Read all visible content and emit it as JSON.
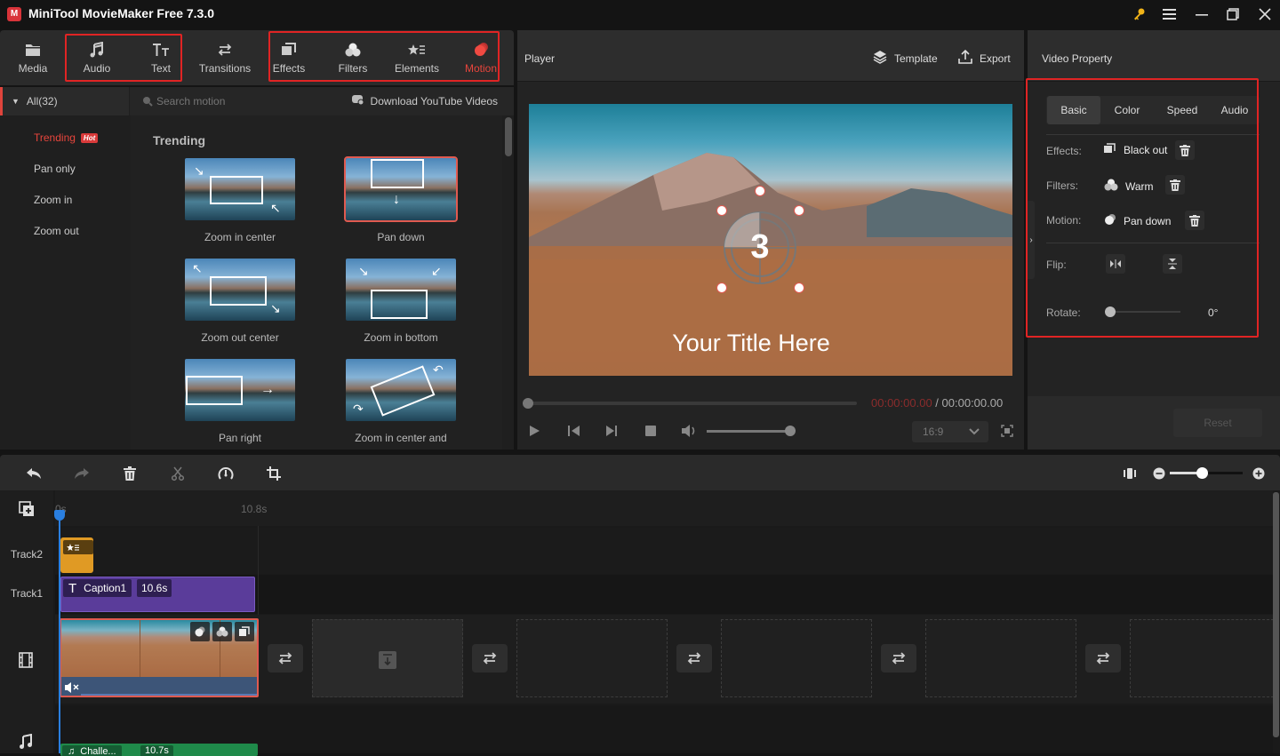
{
  "app": {
    "title": "MiniTool MovieMaker Free 7.3.0",
    "logo_glyph": "M",
    "window_controls": [
      "key-icon",
      "menu-icon",
      "minimize-icon",
      "maximize-icon",
      "close-icon"
    ]
  },
  "toolbar": {
    "items": [
      {
        "id": "media",
        "label": "Media",
        "icon": "folder-icon",
        "active": false
      },
      {
        "id": "audio",
        "label": "Audio",
        "icon": "music-note-icon",
        "active": false
      },
      {
        "id": "text",
        "label": "Text",
        "icon": "text-icon",
        "active": false
      },
      {
        "id": "transitions",
        "label": "Transitions",
        "icon": "swap-icon",
        "active": false
      },
      {
        "id": "effects",
        "label": "Effects",
        "icon": "effects-icon",
        "active": false
      },
      {
        "id": "filters",
        "label": "Filters",
        "icon": "filters-icon",
        "active": false
      },
      {
        "id": "elements",
        "label": "Elements",
        "icon": "elements-icon",
        "active": false
      },
      {
        "id": "motion",
        "label": "Motion",
        "icon": "motion-icon",
        "active": true
      }
    ],
    "active_color": "#e8453c"
  },
  "library": {
    "category_header": "All(32)",
    "categories": [
      {
        "label": "Trending",
        "active": true,
        "badge": "Hot"
      },
      {
        "label": "Pan only",
        "active": false
      },
      {
        "label": "Zoom in",
        "active": false
      },
      {
        "label": "Zoom out",
        "active": false
      }
    ],
    "search_placeholder": "Search motion",
    "download_label": "Download YouTube Videos",
    "section_title": "Trending",
    "items": [
      {
        "label": "Zoom in center",
        "selected": false
      },
      {
        "label": "Pan down",
        "selected": true
      },
      {
        "label": "Zoom out center",
        "selected": false
      },
      {
        "label": "Zoom in bottom",
        "selected": false
      },
      {
        "label": "Pan right",
        "selected": false
      },
      {
        "label": "Zoom in center and",
        "selected": false
      }
    ]
  },
  "player": {
    "title": "Player",
    "template_label": "Template",
    "export_label": "Export",
    "overlay_number": "3",
    "overlay_title": "Your Title Here",
    "current_time": "00:00:00.00",
    "separator": " / ",
    "total_time": "00:00:00.00",
    "aspect_ratio": "16:9",
    "progress": 0,
    "volume": 1.0
  },
  "property": {
    "title": "Video Property",
    "tabs": [
      {
        "label": "Basic",
        "active": true
      },
      {
        "label": "Color",
        "active": false
      },
      {
        "label": "Speed",
        "active": false
      },
      {
        "label": "Audio",
        "active": false
      }
    ],
    "effects_label": "Effects:",
    "effects_value": "Black out",
    "filters_label": "Filters:",
    "filters_value": "Warm",
    "motion_label": "Motion:",
    "motion_value": "Pan down",
    "flip_label": "Flip:",
    "rotate_label": "Rotate:",
    "rotate_value": "0°",
    "rotate_fraction": 0,
    "reset_label": "Reset"
  },
  "timeline": {
    "toolbar": [
      "undo-icon",
      "redo-icon",
      "delete-icon",
      "split-icon",
      "speed-icon",
      "crop-icon"
    ],
    "zoom_level": 0.5,
    "ruler": [
      "0s",
      "10.8s"
    ],
    "tracks": [
      {
        "label": "Track2"
      },
      {
        "label": "Track1"
      }
    ],
    "caption_clip": {
      "label": "Caption1",
      "duration": "10.6s"
    },
    "audio_clip": {
      "label": "Challe...",
      "duration": "10.7s"
    }
  }
}
